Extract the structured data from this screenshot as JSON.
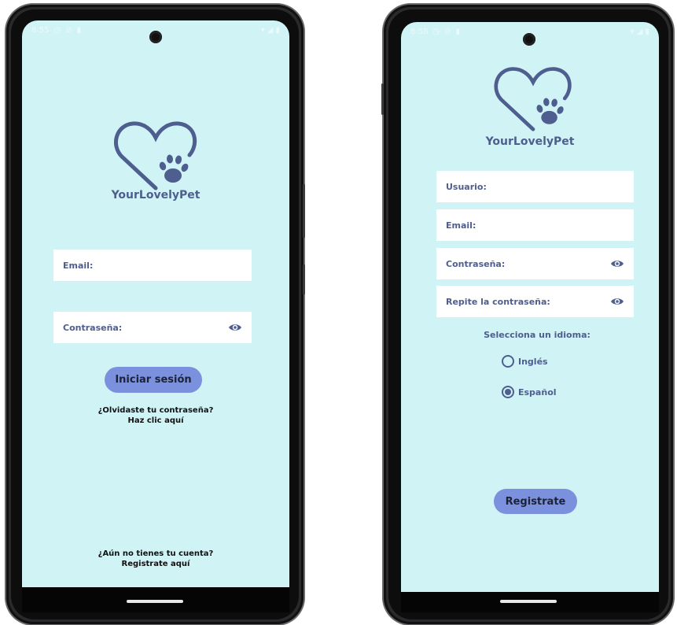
{
  "brand": {
    "app_name": "YourLovelyPet",
    "primary_color": "#4e5e8f",
    "accent_color": "#7c91dd",
    "background_color": "#d0f3f6"
  },
  "login": {
    "status_time": "8:55",
    "email_label": "Email:",
    "password_label": "Contraseña:",
    "login_button": "Iniciar sesión",
    "forgot_line1": "¿Olvidaste tu contraseña?",
    "forgot_line2": "Haz clic aquí",
    "register_line1": "¿Aún no tienes tu cuenta?",
    "register_line2": "Registrate aquí"
  },
  "register": {
    "status_time": "8:58",
    "username_label": "Usuario:",
    "email_label": "Email:",
    "password_label": "Contraseña:",
    "repeat_password_label": "Repite la contraseña:",
    "language_title": "Selecciona un idioma:",
    "language_options": [
      {
        "label": "Inglés",
        "selected": false
      },
      {
        "label": "Español",
        "selected": true
      }
    ],
    "register_button": "Registrate"
  },
  "icons": [
    "heart-paw-logo",
    "eye-icon",
    "camera-hole",
    "wifi-icon",
    "signal-icon",
    "battery-icon"
  ]
}
